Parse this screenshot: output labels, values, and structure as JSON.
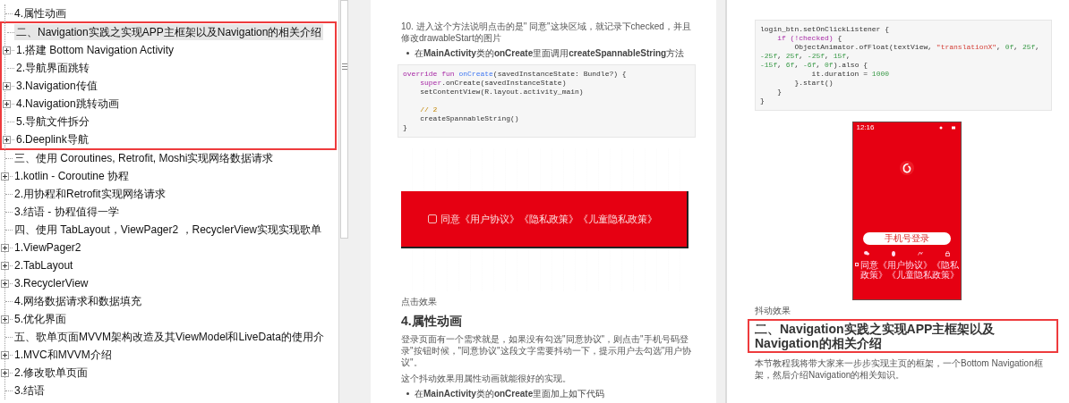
{
  "sidebar": {
    "items": [
      {
        "text": "4.属性动画",
        "expandable": false,
        "selected": false,
        "boxed": false
      },
      {
        "text": "二、Navigation实践之实现APP主框架以及Navigation的相关介绍",
        "expandable": false,
        "selected": true,
        "boxed": true
      },
      {
        "text": "1.搭建 Bottom Navigation Activity",
        "expandable": true,
        "selected": false,
        "boxed": true
      },
      {
        "text": "2.导航界面跳转",
        "expandable": false,
        "selected": false,
        "boxed": true
      },
      {
        "text": "3.Navigation传值",
        "expandable": true,
        "selected": false,
        "boxed": true
      },
      {
        "text": "4.Navigation跳转动画",
        "expandable": true,
        "selected": false,
        "boxed": true
      },
      {
        "text": "5.导航文件拆分",
        "expandable": false,
        "selected": false,
        "boxed": true
      },
      {
        "text": "6.Deeplink导航",
        "expandable": true,
        "selected": false,
        "boxed": true
      },
      {
        "text": "三、使用 Coroutines, Retrofit, Moshi实现网络数据请求",
        "expandable": false,
        "selected": false,
        "boxed": false
      },
      {
        "text": "1.kotlin - Coroutine 协程",
        "expandable": true,
        "selected": false,
        "boxed": false
      },
      {
        "text": "2.用协程和Retrofit实现网络请求",
        "expandable": false,
        "selected": false,
        "boxed": false
      },
      {
        "text": "3.结语 - 协程值得一学",
        "expandable": false,
        "selected": false,
        "boxed": false
      },
      {
        "text": "四、使用 TabLayout，ViewPager2 ，RecyclerView实现实现歌单",
        "expandable": false,
        "selected": false,
        "boxed": false
      },
      {
        "text": "1.ViewPager2",
        "expandable": true,
        "selected": false,
        "boxed": false
      },
      {
        "text": "2.TabLayout",
        "expandable": true,
        "selected": false,
        "boxed": false
      },
      {
        "text": "3.RecyclerView",
        "expandable": true,
        "selected": false,
        "boxed": false
      },
      {
        "text": "4.网络数据请求和数据填充",
        "expandable": false,
        "selected": false,
        "boxed": false
      },
      {
        "text": "5.优化界面",
        "expandable": true,
        "selected": false,
        "boxed": false
      },
      {
        "text": "五、歌单页面MVVM架构改造及其ViewModel和LiveData的使用介",
        "expandable": false,
        "selected": false,
        "boxed": false
      },
      {
        "text": "1.MVC和MVVM介绍",
        "expandable": true,
        "selected": false,
        "boxed": false
      },
      {
        "text": "2.修改歌单页面",
        "expandable": true,
        "selected": false,
        "boxed": false
      },
      {
        "text": "3.结语",
        "expandable": false,
        "selected": false,
        "boxed": false
      }
    ]
  },
  "page_1": {
    "blocks": [
      {
        "kind": "paragraph",
        "text": "10. 进入这个方法说明点击的是\" 同意\"这块区域，就记录下checked，并且修改drawableStart的图片"
      },
      {
        "kind": "bullet",
        "text": "在**MainActivity**类的**onCreate**里面调用**createSpannableString**方法"
      },
      {
        "kind": "code",
        "lines": [
          {
            "tokens": [
              {
                "kind": "keyword",
                "text": "override fun "
              },
              {
                "kind": "function",
                "text": "onCreate"
              },
              {
                "kind": "plain",
                "text": "(savedInstanceState: Bundle?) {"
              }
            ]
          },
          {
            "tokens": [
              {
                "kind": "keyword",
                "text": "    super"
              },
              {
                "kind": "plain",
                "text": ".onCreate(savedInstanceState)"
              }
            ]
          },
          {
            "tokens": [
              {
                "kind": "plain",
                "text": "    setContentView(R.layout.activity_main)"
              }
            ]
          },
          {
            "blank": true
          },
          {
            "tokens": [
              {
                "kind": "comment",
                "text": "    // 2"
              }
            ]
          },
          {
            "tokens": [
              {
                "kind": "plain",
                "text": "    createSpannableString()"
              }
            ]
          },
          {
            "tokens": [
              {
                "kind": "plain",
                "text": "}"
              }
            ]
          }
        ]
      },
      {
        "kind": "agreement_image",
        "checked": false,
        "text": "同意《用户协议》《隐私政策》《儿童隐私政策》"
      },
      {
        "kind": "caption",
        "text": "点击效果"
      },
      {
        "kind": "heading",
        "text": "4.属性动画",
        "boxed": false
      },
      {
        "kind": "paragraph",
        "text": "登录页面有一个需求就是，如果没有勾选\"同意协议\"，则点击\"手机号码登录\"按钮时候，\"同意协议\"这段文字需要抖动一下，提示用户去勾选\"用户协议\"。"
      },
      {
        "kind": "paragraph",
        "text": "这个抖动效果用属性动画就能很好的实现。"
      },
      {
        "kind": "bullet",
        "text": "在**MainActivity**类的**onCreate**里面加上如下代码"
      }
    ]
  },
  "page_2": {
    "blocks": [
      {
        "kind": "code",
        "lines": [
          {
            "tokens": [
              {
                "kind": "plain",
                "text": "login_btn.setOnClickListener {"
              }
            ]
          },
          {
            "tokens": [
              {
                "kind": "keyword",
                "text": "    if (!checked)"
              },
              {
                "kind": "plain",
                "text": " {"
              }
            ]
          },
          {
            "tokens": [
              {
                "kind": "plain",
                "text": "        ObjectAnimator.ofFloat(textView, "
              },
              {
                "kind": "string",
                "text": "\"translationX\""
              },
              {
                "kind": "plain",
                "text": ", "
              },
              {
                "kind": "number",
                "text": "0f"
              },
              {
                "kind": "plain",
                "text": ", "
              },
              {
                "kind": "number",
                "text": "25f"
              },
              {
                "kind": "plain",
                "text": ", "
              },
              {
                "kind": "number",
                "text": "-25f"
              },
              {
                "kind": "plain",
                "text": ", "
              },
              {
                "kind": "number",
                "text": "25f"
              },
              {
                "kind": "plain",
                "text": ", "
              },
              {
                "kind": "number",
                "text": "-25f"
              },
              {
                "kind": "plain",
                "text": ", "
              },
              {
                "kind": "number",
                "text": "15f"
              },
              {
                "kind": "plain",
                "text": ","
              }
            ]
          },
          {
            "tokens": [
              {
                "kind": "number",
                "text": "-15f"
              },
              {
                "kind": "plain",
                "text": ", "
              },
              {
                "kind": "number",
                "text": "6f"
              },
              {
                "kind": "plain",
                "text": ", "
              },
              {
                "kind": "number",
                "text": "-6f"
              },
              {
                "kind": "plain",
                "text": ", "
              },
              {
                "kind": "number",
                "text": "0f"
              },
              {
                "kind": "plain",
                "text": ").also {"
              }
            ]
          },
          {
            "tokens": [
              {
                "kind": "plain",
                "text": "            it.duration = "
              },
              {
                "kind": "number",
                "text": "1000"
              }
            ]
          },
          {
            "tokens": [
              {
                "kind": "plain",
                "text": "        }.start()"
              }
            ]
          },
          {
            "tokens": [
              {
                "kind": "plain",
                "text": "    }"
              }
            ]
          },
          {
            "tokens": [
              {
                "kind": "plain",
                "text": "}"
              }
            ]
          }
        ]
      },
      {
        "kind": "phone_image",
        "time": "12:16",
        "button": "手机号登录",
        "checked": false,
        "agreement": "同意《用户协议》《隐私政策》《儿童隐私政策》"
      },
      {
        "kind": "caption",
        "text": "抖动效果"
      },
      {
        "kind": "heading",
        "text": "二、Navigation实践之实现APP主框架以及Navigation的相关介绍",
        "boxed": true
      },
      {
        "kind": "paragraph",
        "text": "本节教程我将带大家来一步步实现主页的框架，一个Bottom Navigation框架，然后介绍Navigation的相关知识。"
      }
    ]
  }
}
